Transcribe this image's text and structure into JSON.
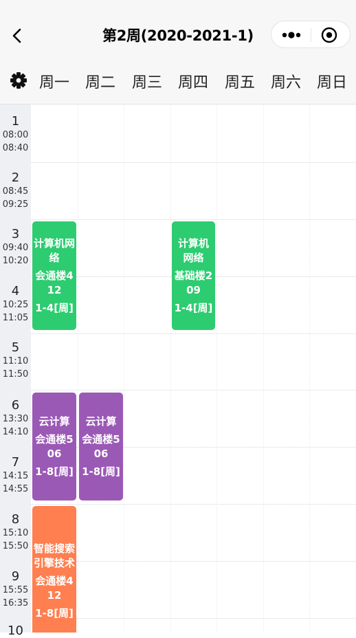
{
  "header": {
    "title": "第2周(2020-2021-1)"
  },
  "weekdays": [
    "周一",
    "周二",
    "周三",
    "周四",
    "周五",
    "周六",
    "周日"
  ],
  "slots": [
    {
      "n": "1",
      "start": "08:00",
      "end": "08:40"
    },
    {
      "n": "2",
      "start": "08:45",
      "end": "09:25"
    },
    {
      "n": "3",
      "start": "09:40",
      "end": "10:20"
    },
    {
      "n": "4",
      "start": "10:25",
      "end": "11:05"
    },
    {
      "n": "5",
      "start": "11:10",
      "end": "11:50"
    },
    {
      "n": "6",
      "start": "13:30",
      "end": "14:10"
    },
    {
      "n": "7",
      "start": "14:15",
      "end": "14:55"
    },
    {
      "n": "8",
      "start": "15:10",
      "end": "15:50"
    },
    {
      "n": "9",
      "start": "15:55",
      "end": "16:35"
    },
    {
      "n": "10",
      "start": "",
      "end": ""
    }
  ],
  "courses": [
    {
      "name": "计算机网络",
      "room": "会通楼412",
      "weeks": "1-4[周]",
      "day": 1,
      "start": 3,
      "span": 2,
      "color": "#2ecc71"
    },
    {
      "name": "计算机网络",
      "room": "基础楼209",
      "weeks": "1-4[周]",
      "day": 4,
      "start": 3,
      "span": 2,
      "color": "#2ecc71"
    },
    {
      "name": "云计算",
      "room": "会通楼506",
      "weeks": "1-8[周]",
      "day": 1,
      "start": 6,
      "span": 2,
      "color": "#9b59b6"
    },
    {
      "name": "云计算",
      "room": "会通楼506",
      "weeks": "1-8[周]",
      "day": 2,
      "start": 6,
      "span": 2,
      "color": "#9b59b6"
    },
    {
      "name": "智能搜索引擎技术",
      "room": "会通楼412",
      "weeks": "1-8[周]",
      "day": 1,
      "start": 8,
      "span": 3,
      "color": "#ff7f50"
    }
  ]
}
